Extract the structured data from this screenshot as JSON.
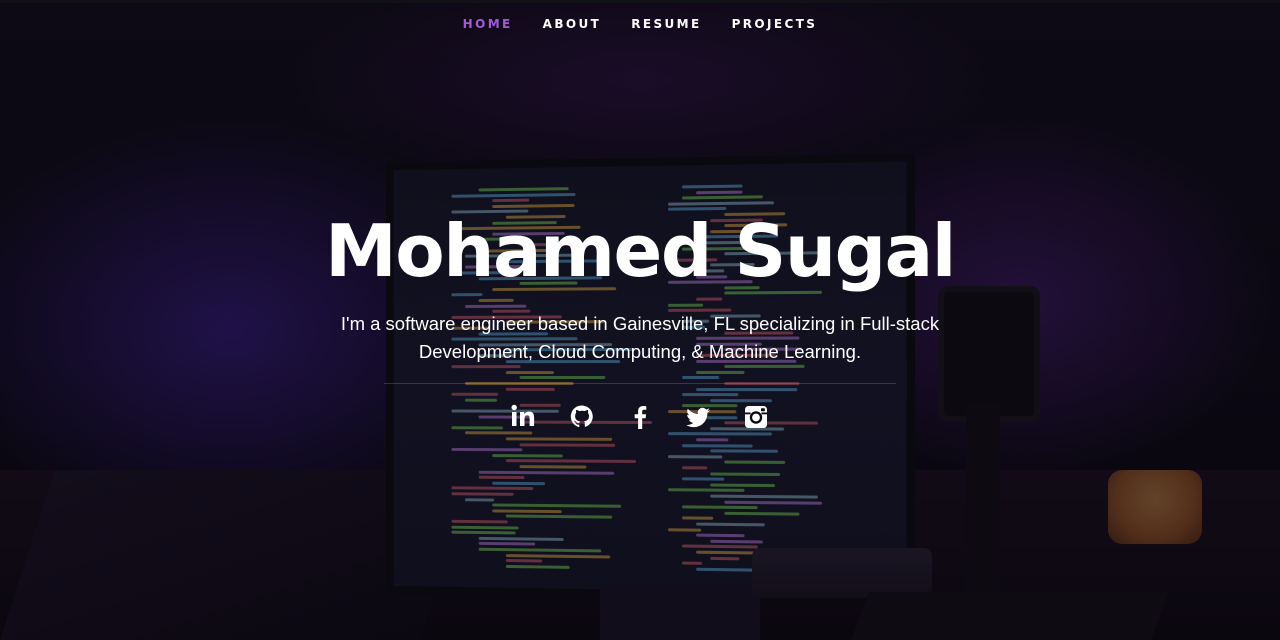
{
  "nav": {
    "items": [
      {
        "label": "HOME",
        "active": true
      },
      {
        "label": "ABOUT",
        "active": false
      },
      {
        "label": "RESUME",
        "active": false
      },
      {
        "label": "PROJECTS",
        "active": false
      }
    ]
  },
  "hero": {
    "title": "Mohamed Sugal",
    "description": "I'm a software engineer based in Gainesville, FL specializing in Full-stack Development, Cloud Computing, & Machine Learning."
  },
  "social": [
    {
      "name": "linkedin-icon"
    },
    {
      "name": "github-icon"
    },
    {
      "name": "facebook-icon"
    },
    {
      "name": "twitter-icon"
    },
    {
      "name": "instagram-icon"
    }
  ],
  "colors": {
    "accent": "#a25bd8",
    "text": "#ffffff",
    "background": "#0b0812"
  }
}
